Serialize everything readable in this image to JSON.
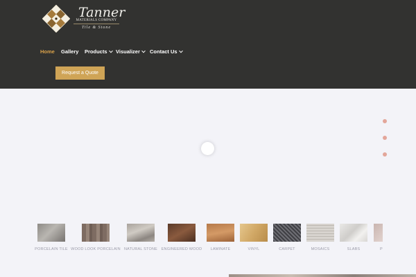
{
  "brand": {
    "name": "Tanner",
    "subtitle": "MATERIALS COMPANY",
    "tagline": "Tile & Stone"
  },
  "nav": {
    "items": [
      {
        "label": "Home",
        "active": true,
        "dropdown": false
      },
      {
        "label": "Gallery",
        "active": false,
        "dropdown": false
      },
      {
        "label": "Products",
        "active": false,
        "dropdown": true
      },
      {
        "label": "Visualizer",
        "active": false,
        "dropdown": true
      },
      {
        "label": "Contact Us",
        "active": false,
        "dropdown": true
      }
    ]
  },
  "cta": {
    "label": "Request a Quote"
  },
  "slider": {
    "dot_count": 3
  },
  "categories": [
    {
      "label": "PORCELAIN TILE"
    },
    {
      "label": "WOOD LOOK PORCELAIN"
    },
    {
      "label": "NATURAL STONE"
    },
    {
      "label": "ENGINEERED WOOD"
    },
    {
      "label": "LAMINATE"
    },
    {
      "label": "VINYL"
    },
    {
      "label": "CARPET"
    },
    {
      "label": "MOSAICS"
    },
    {
      "label": "SLABS"
    },
    {
      "label": "P"
    }
  ],
  "colors": {
    "header_bg": "#323230",
    "accent": "#cfa456",
    "active_nav": "#d9a24a",
    "page_bg": "#f3f3f8",
    "slider_dot": "#e3a69a"
  }
}
